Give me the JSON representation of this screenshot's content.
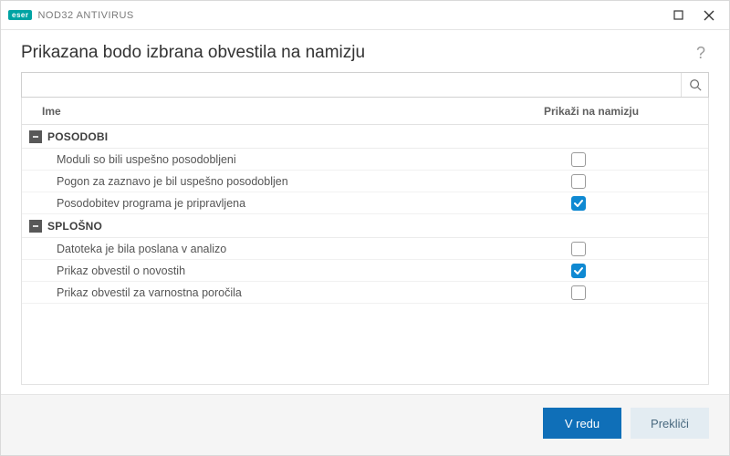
{
  "brand": {
    "logo": "eser",
    "product": "NOD32 ANTIVIRUS"
  },
  "header": {
    "title": "Prikazana bodo izbrana obvestila na namizju",
    "help": "?"
  },
  "search": {
    "value": "",
    "placeholder": ""
  },
  "columns": {
    "name": "Ime",
    "desktop": "Prikaži na namizju"
  },
  "groups": [
    {
      "label": "POSODOBI",
      "items": [
        {
          "label": "Moduli so bili uspešno posodobljeni",
          "checked": false
        },
        {
          "label": "Pogon za zaznavo je bil uspešno posodobljen",
          "checked": false
        },
        {
          "label": "Posodobitev programa je pripravljena",
          "checked": true
        }
      ]
    },
    {
      "label": "SPLOŠNO",
      "items": [
        {
          "label": "Datoteka je bila poslana v analizo",
          "checked": false
        },
        {
          "label": "Prikaz obvestil o novostih",
          "checked": true
        },
        {
          "label": "Prikaz obvestil za varnostna poročila",
          "checked": false
        }
      ]
    }
  ],
  "footer": {
    "ok": "V redu",
    "cancel": "Prekliči"
  }
}
